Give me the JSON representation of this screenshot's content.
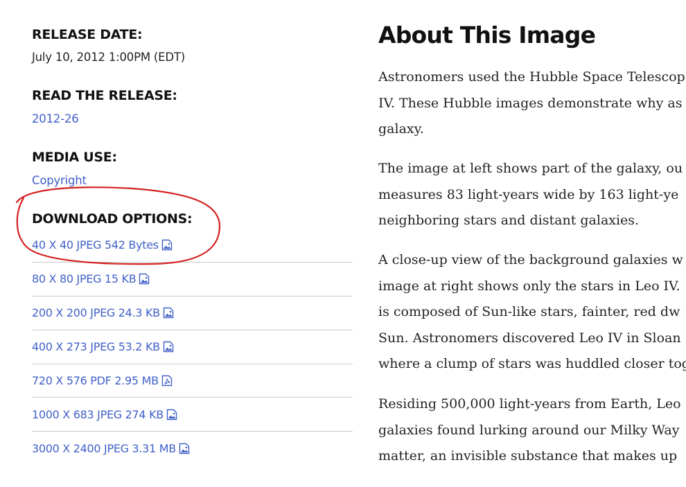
{
  "meta": {
    "release_date_label": "RELEASE DATE:",
    "release_date_value": "July 10, 2012 1:00PM (EDT)",
    "read_release_label": "READ THE RELEASE:",
    "read_release_link": "2012-26",
    "media_use_label": "MEDIA USE:",
    "media_use_link": "Copyright",
    "download_label": "DOWNLOAD OPTIONS:"
  },
  "downloads": [
    {
      "label": "40 X 40 JPEG 542 Bytes",
      "icon": "image-file-icon"
    },
    {
      "label": "80 X 80 JPEG 15 KB",
      "icon": "image-file-icon"
    },
    {
      "label": "200 X 200 JPEG 24.3 KB",
      "icon": "image-file-icon"
    },
    {
      "label": "400 X 273 JPEG 53.2 KB",
      "icon": "image-file-icon"
    },
    {
      "label": "720 X 576 PDF 2.95 MB",
      "icon": "pdf-file-icon"
    },
    {
      "label": "1000 X 683 JPEG 274 KB",
      "icon": "image-file-icon"
    },
    {
      "label": "3000 X 2400 JPEG 3.31 MB",
      "icon": "image-file-icon"
    }
  ],
  "about": {
    "title": "About This Image",
    "paragraphs": [
      [
        "Astronomers used the Hubble Space Telescop",
        "IV. These Hubble images demonstrate why as",
        "galaxy."
      ],
      [
        "The image at left shows part of the galaxy, ou",
        "measures 83 light-years wide by 163 light-ye",
        "neighboring stars and distant galaxies."
      ],
      [
        "A close-up view of the background galaxies w",
        "image at right shows only the stars in Leo IV.",
        "is composed of Sun-like stars, fainter, red dw",
        "Sun. Astronomers discovered Leo IV in Sloan",
        "where a clump of stars was huddled closer tog"
      ],
      [
        "Residing 500,000 light-years from Earth, Leo",
        "galaxies found lurking around our Milky Way",
        "matter, an invisible substance that makes up"
      ]
    ]
  },
  "colors": {
    "link": "#4060c8",
    "annotation": "#d42020",
    "divider": "#c8c8c8"
  }
}
